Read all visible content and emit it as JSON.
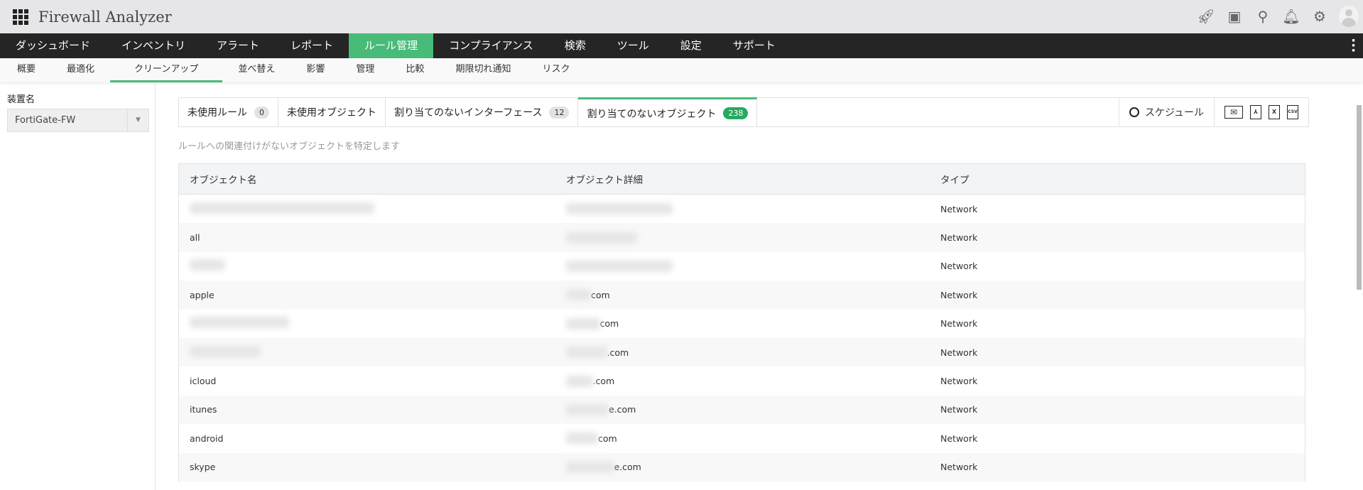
{
  "app": {
    "title": "Firewall Analyzer"
  },
  "header_icons": [
    "rocket-icon",
    "presentation-icon",
    "search-icon",
    "bell-icon",
    "gear-icon",
    "avatar-icon"
  ],
  "nav": {
    "items": [
      "ダッシュボード",
      "インベントリ",
      "アラート",
      "レポート",
      "ルール管理",
      "コンプライアンス",
      "検索",
      "ツール",
      "設定",
      "サポート"
    ],
    "active": "ルール管理"
  },
  "subnav": {
    "items": [
      "概要",
      "最適化",
      "クリーンアップ",
      "並べ替え",
      "影響",
      "管理",
      "比較",
      "期限切れ通知",
      "リスク"
    ],
    "active": "クリーンアップ"
  },
  "sidebar": {
    "device_label": "装置名",
    "device_value": "FortiGate-FW"
  },
  "tabs": [
    {
      "label": "未使用ルール",
      "count": "0"
    },
    {
      "label": "未使用オブジェクト"
    },
    {
      "label": "割り当てのないインターフェース",
      "count": "12"
    },
    {
      "label": "割り当てのないオブジェクト",
      "count": "238",
      "active": true
    }
  ],
  "toolbar": {
    "schedule": "スケジュール",
    "exports": {
      "pdf": "",
      "xls": "X",
      "csv": "CSV"
    }
  },
  "description": "ルールへの関連付けがないオブジェクトを特定します",
  "table": {
    "headers": [
      "オブジェクト名",
      "オブジェクト詳細",
      "タイプ"
    ],
    "rows": [
      {
        "name": "",
        "detail": "",
        "type": "Network"
      },
      {
        "name": "all",
        "detail": "",
        "type": "Network"
      },
      {
        "name": "",
        "detail": "",
        "type": "Network"
      },
      {
        "name": "apple",
        "detail": "com",
        "type": "Network"
      },
      {
        "name": "",
        "detail": "com",
        "type": "Network"
      },
      {
        "name": "",
        "detail": ".com",
        "type": "Network"
      },
      {
        "name": "icloud",
        "detail": ".com",
        "type": "Network"
      },
      {
        "name": "itunes",
        "detail": "e.com",
        "type": "Network"
      },
      {
        "name": "android",
        "detail": "com",
        "type": "Network"
      },
      {
        "name": "skype",
        "detail": "e.com",
        "type": "Network"
      }
    ]
  },
  "colors": {
    "accent": "#48bb78",
    "nav_bg": "#252525",
    "badge_green": "#27a95f"
  }
}
